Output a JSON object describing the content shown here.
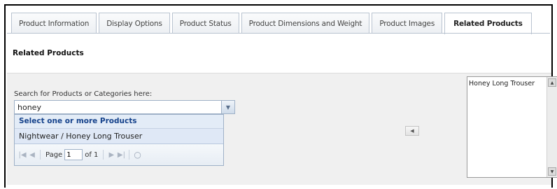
{
  "tabs": [
    {
      "label": "Product Information",
      "active": false
    },
    {
      "label": "Display Options",
      "active": false
    },
    {
      "label": "Product Status",
      "active": false
    },
    {
      "label": "Product Dimensions and Weight",
      "active": false
    },
    {
      "label": "Product Images",
      "active": false
    },
    {
      "label": "Related Products",
      "active": true
    }
  ],
  "section": {
    "title": "Related Products"
  },
  "search": {
    "label": "Search for Products or Categories here:",
    "value": "honey",
    "dropdown_header": "Select one or more Products",
    "results": [
      "Nightwear / Honey Long Trouser"
    ]
  },
  "pager": {
    "page_label": "Page",
    "page_value": "1",
    "of_label": "of 1"
  },
  "selected_list": {
    "items": [
      "Honey Long Trouser"
    ]
  },
  "icons": {
    "dropdown": "chevron-down-icon",
    "first": "first-page-icon",
    "prev": "prev-page-icon",
    "next": "next-page-icon",
    "last": "last-page-icon",
    "refresh": "refresh-icon",
    "move": "move-left-icon"
  }
}
